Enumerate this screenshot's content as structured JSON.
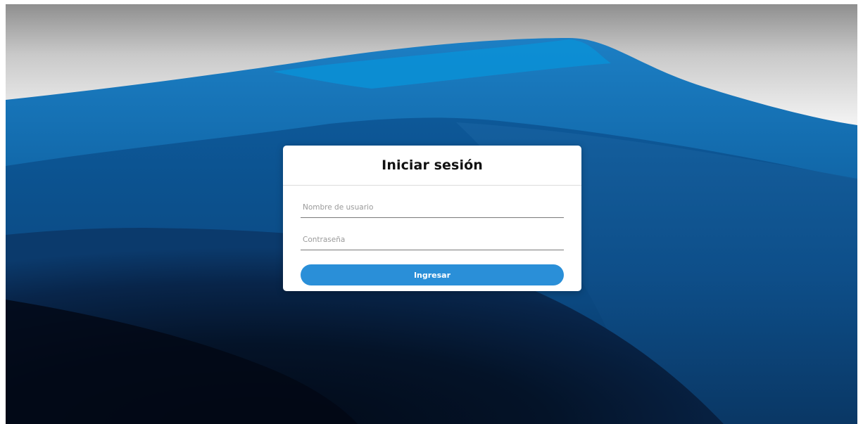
{
  "login": {
    "title": "Iniciar sesión",
    "username": {
      "value": "",
      "placeholder": "Nombre de usuario"
    },
    "password": {
      "value": "",
      "placeholder": "Contraseña"
    },
    "submit_label": "Ingresar"
  },
  "colors": {
    "accent": "#2a8fd8",
    "card_background": "#ffffff",
    "title_text": "#111111",
    "placeholder_text": "#9a9a9a"
  },
  "icons": {
    "background": "desert-dunes-wallpaper"
  }
}
